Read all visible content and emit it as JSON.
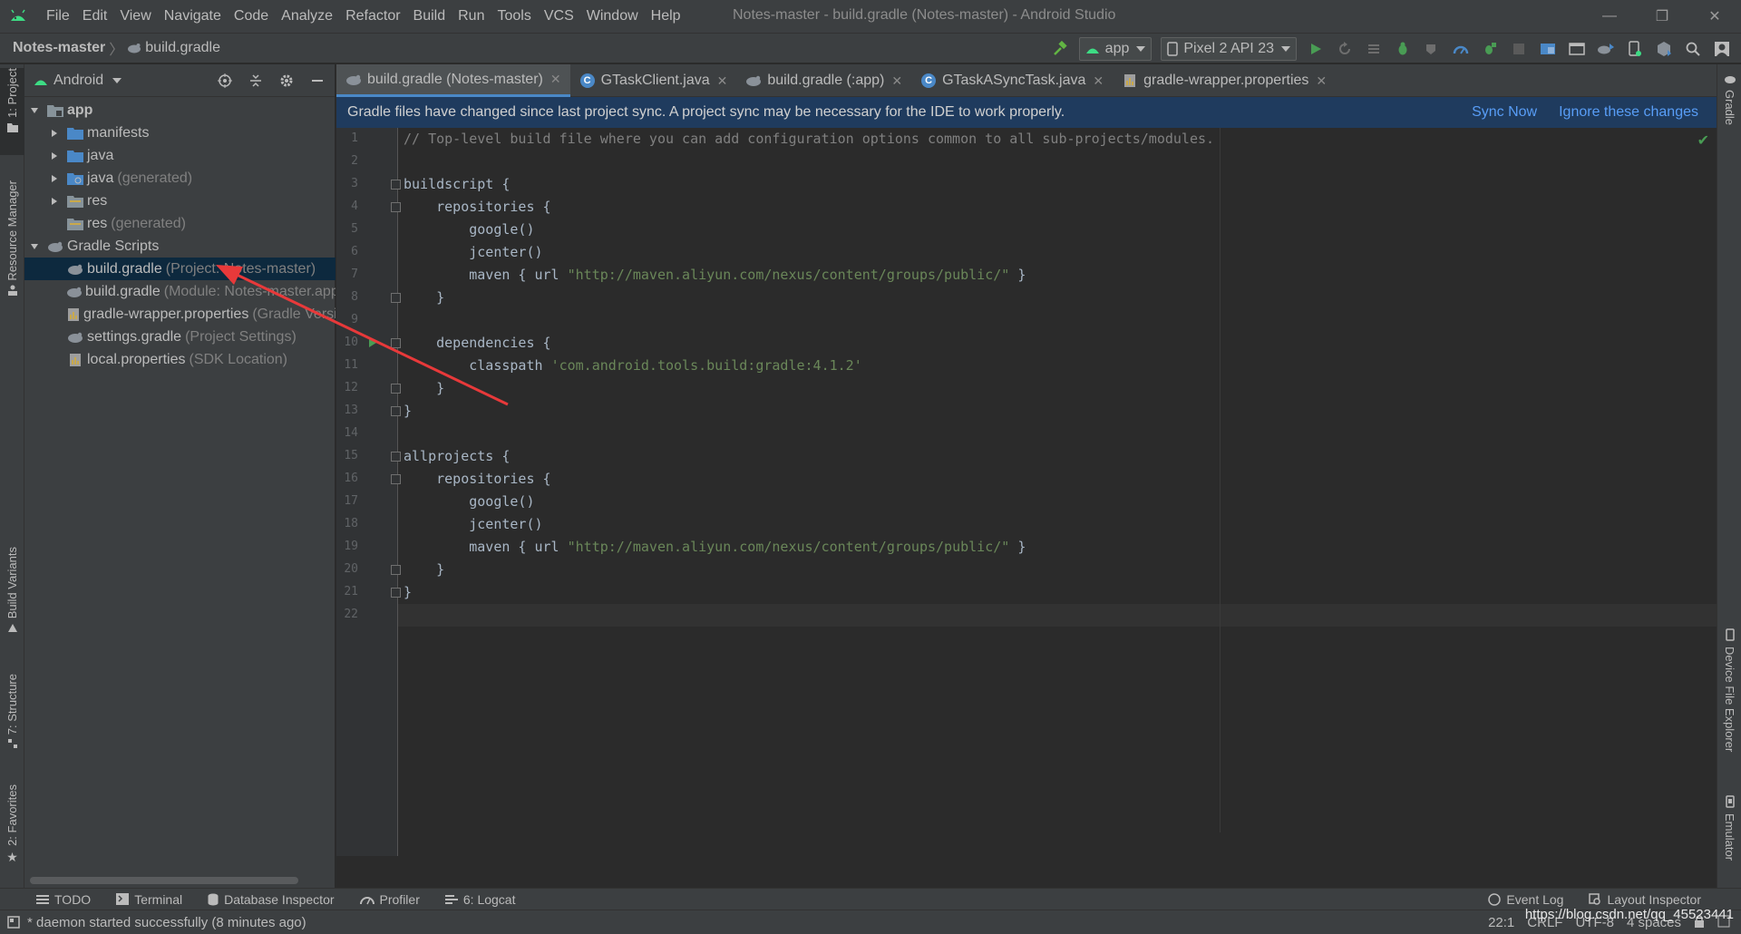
{
  "window": {
    "title": "Notes-master - build.gradle (Notes-master) - Android Studio",
    "minimize": "—",
    "restore": "❐",
    "close": "✕"
  },
  "menu": [
    "File",
    "Edit",
    "View",
    "Navigate",
    "Code",
    "Analyze",
    "Refactor",
    "Build",
    "Run",
    "Tools",
    "VCS",
    "Window",
    "Help"
  ],
  "breadcrumb": {
    "project": "Notes-master",
    "separator": "〉",
    "file": "build.gradle"
  },
  "toolbar": {
    "config": "app",
    "device": "Pixel 2 API 23"
  },
  "left_tools": {
    "project": "1: Project",
    "resource_manager": "Resource Manager",
    "build_variants": "Build Variants",
    "structure": "7: Structure",
    "favorites": "2: Favorites"
  },
  "right_tools": {
    "gradle": "Gradle",
    "device_file_explorer": "Device File Explorer",
    "emulator": "Emulator"
  },
  "project_panel": {
    "view": "Android",
    "tree": [
      {
        "label": "app",
        "hint": "",
        "bold": true
      },
      {
        "label": "manifests",
        "hint": ""
      },
      {
        "label": "java",
        "hint": ""
      },
      {
        "label": "java",
        "hint": "(generated)"
      },
      {
        "label": "res",
        "hint": ""
      },
      {
        "label": "res",
        "hint": "(generated)"
      },
      {
        "label": "Gradle Scripts",
        "hint": ""
      },
      {
        "label": "build.gradle",
        "hint": "(Project: Notes-master)"
      },
      {
        "label": "build.gradle",
        "hint": "(Module: Notes-master.app)"
      },
      {
        "label": "gradle-wrapper.properties",
        "hint": "(Gradle Version)"
      },
      {
        "label": "settings.gradle",
        "hint": "(Project Settings)"
      },
      {
        "label": "local.properties",
        "hint": "(SDK Location)"
      }
    ]
  },
  "tabs": [
    {
      "label": "build.gradle (Notes-master)",
      "icon": "gradle-icon"
    },
    {
      "label": "GTaskClient.java",
      "icon": "class-icon"
    },
    {
      "label": "build.gradle (:app)",
      "icon": "gradle-icon"
    },
    {
      "label": "GTaskASyncTask.java",
      "icon": "class-icon"
    },
    {
      "label": "gradle-wrapper.properties",
      "icon": "properties-icon"
    }
  ],
  "sync_banner": {
    "message": "Gradle files have changed since last project sync. A project sync may be necessary for the IDE to work properly.",
    "sync_now": "Sync Now",
    "ignore": "Ignore these changes"
  },
  "editor": {
    "lines": [
      "// Top-level build file where you can add configuration options common to all sub-projects/modules.",
      "",
      "buildscript {",
      "    repositories {",
      "        google()",
      "        jcenter()",
      "        maven { url \"http://maven.aliyun.com/nexus/content/groups/public/\" }",
      "    }",
      "",
      "    dependencies {",
      "        classpath 'com.android.tools.build:gradle:4.1.2'",
      "    }",
      "}",
      "",
      "allprojects {",
      "    repositories {",
      "        google()",
      "        jcenter()",
      "        maven { url \"http://maven.aliyun.com/nexus/content/groups/public/\" }",
      "    }",
      "}",
      ""
    ]
  },
  "bottom_tools": {
    "todo": "TODO",
    "terminal": "Terminal",
    "database": "Database Inspector",
    "profiler": "Profiler",
    "logcat": "6: Logcat",
    "event_log": "Event Log",
    "layout_inspector": "Layout Inspector"
  },
  "status": {
    "message": "* daemon started successfully (8 minutes ago)",
    "position": "22:1",
    "line_sep": "CRLF",
    "encoding": "UTF-8",
    "indent": "4 spaces"
  },
  "watermark": "https://blog.csdn.net/qq_45523441",
  "colors": {
    "accent": "#4a88c7",
    "banner": "#1f3b5e",
    "link": "#589df6",
    "string": "#6a8759",
    "comment": "#808080",
    "annotation": "#e8393a"
  }
}
